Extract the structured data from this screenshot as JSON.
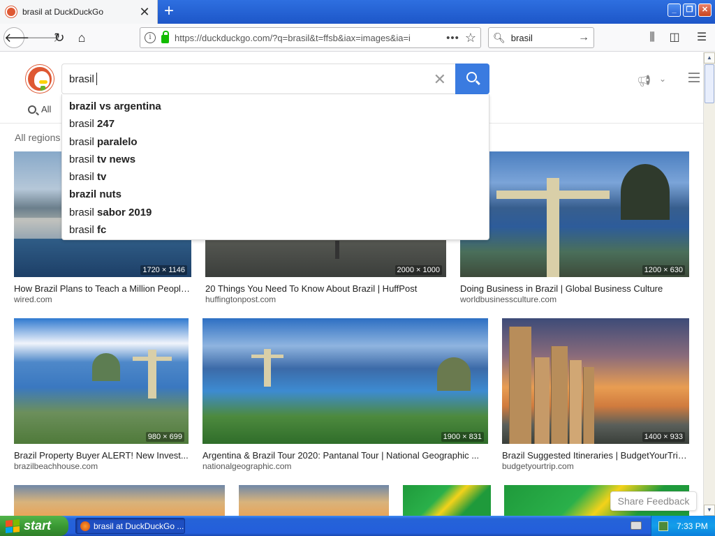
{
  "browser": {
    "tab_title": "brasil at DuckDuckGo",
    "tab_close": "✕",
    "new_tab": "+",
    "url": "https://duckduckgo.com/?q=brasil&t=ffsb&iax=images&ia=i",
    "url_more": "•••",
    "search_value": "brasil",
    "window_min": "_",
    "window_max": "❐",
    "window_close": "✕"
  },
  "ddg": {
    "query": "brasil",
    "clear": "✕",
    "tab_all": "All",
    "regions": "All regions",
    "suggestions": [
      {
        "prefix": "",
        "bold": "brazil vs argentina"
      },
      {
        "prefix": "brasil ",
        "bold": "247"
      },
      {
        "prefix": "brasil ",
        "bold": "paralelo"
      },
      {
        "prefix": "brasil ",
        "bold": "tv news"
      },
      {
        "prefix": "brasil ",
        "bold": "tv"
      },
      {
        "prefix": "",
        "bold": "brazil nuts"
      },
      {
        "prefix": "brasil ",
        "bold": "sabor 2019"
      },
      {
        "prefix": "brasil ",
        "bold": "fc"
      }
    ],
    "results": [
      {
        "dims": "1720 × 1146",
        "title": "How Brazil Plans to Teach a Million People ...",
        "source": "wired.com"
      },
      {
        "dims": "2000 × 1000",
        "title": "20 Things You Need To Know About Brazil | HuffPost",
        "source": "huffingtonpost.com"
      },
      {
        "dims": "1200 × 630",
        "title": "Doing Business in Brazil | Global Business Culture",
        "source": "worldbusinessculture.com"
      },
      {
        "dims": "980 × 699",
        "title": "Brazil Property Buyer ALERT! New Invest...",
        "source": "brazilbeachhouse.com"
      },
      {
        "dims": "1900 × 831",
        "title": "Argentina & Brazil Tour 2020: Pantanal Tour | National Geographic ...",
        "source": "nationalgeographic.com"
      },
      {
        "dims": "1400 × 933",
        "title": "Brazil Suggested Itineraries | BudgetYourTrip....",
        "source": "budgetyourtrip.com"
      }
    ],
    "feedback": "Share Feedback"
  },
  "taskbar": {
    "start": "start",
    "task": "brasil at DuckDuckGo ...",
    "clock": "7:33 PM"
  }
}
